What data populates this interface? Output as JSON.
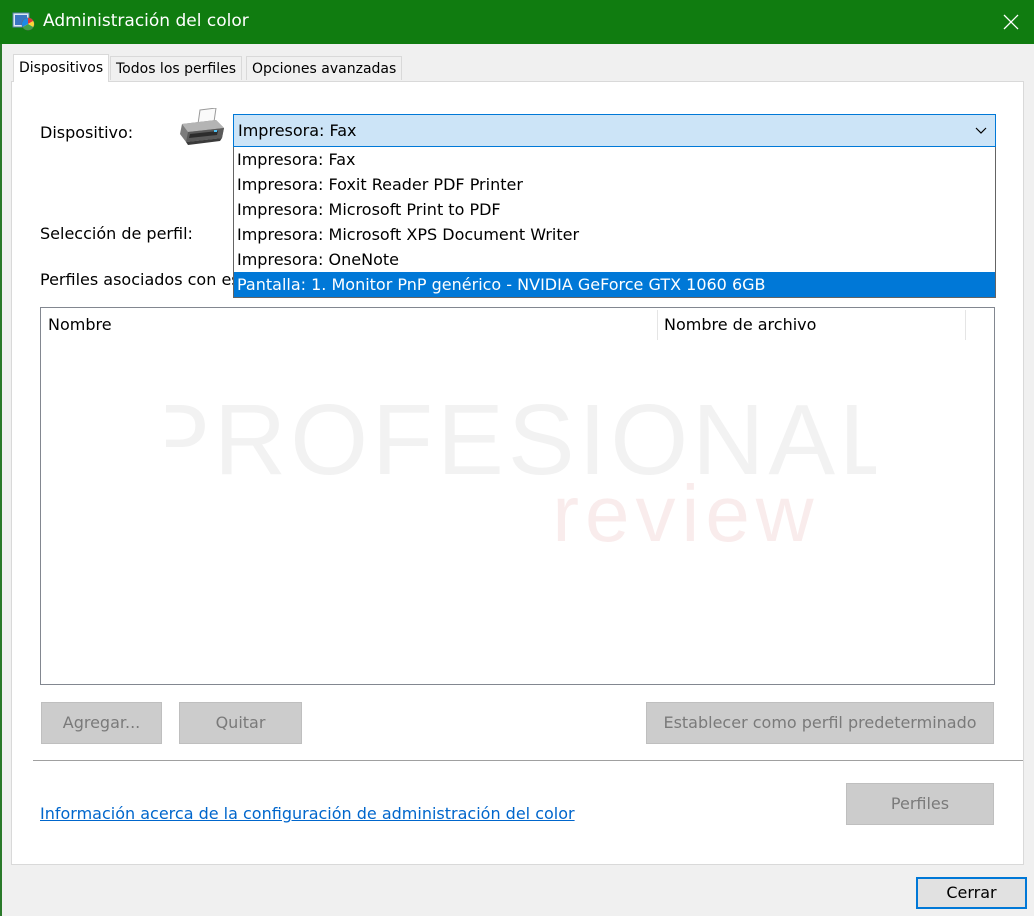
{
  "window": {
    "title": "Administración del color"
  },
  "tabs": [
    {
      "label": "Dispositivos",
      "active": true
    },
    {
      "label": "Todos los perfiles",
      "active": false
    },
    {
      "label": "Opciones avanzadas",
      "active": false
    }
  ],
  "device": {
    "label": "Dispositivo:",
    "selected": "Impresora: Fax",
    "options": [
      "Impresora: Fax",
      "Impresora: Foxit Reader PDF Printer",
      "Impresora: Microsoft Print to PDF",
      "Impresora: Microsoft XPS Document Writer",
      "Impresora: OneNote",
      "Pantalla: 1. Monitor PnP genérico - NVIDIA GeForce GTX 1060 6GB"
    ],
    "highlighted_index": 5
  },
  "profile_selection_label": "Selección de perfil:",
  "associated_profiles_label": "Perfiles asociados con es",
  "profiles_table": {
    "columns": [
      "Nombre",
      "Nombre de archivo"
    ],
    "rows": []
  },
  "watermark": {
    "top": "PROFESIONAL",
    "bottom": "review"
  },
  "buttons": {
    "add": "Agregar...",
    "remove": "Quitar",
    "set_default": "Establecer como perfil predeterminado",
    "profiles": "Perfiles",
    "close": "Cerrar"
  },
  "info_link": "Información acerca de la configuración de administración del color",
  "colors": {
    "titlebar": "#107c10",
    "accent": "#0078d7",
    "combo_bg": "#cce4f7",
    "link": "#0066cc",
    "disabled_button": "#cccccc"
  }
}
